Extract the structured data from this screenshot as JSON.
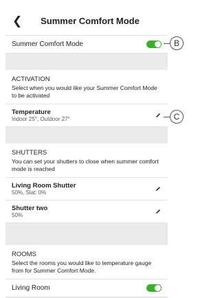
{
  "header": {
    "title": "Summer Comfort Mode",
    "back_icon": "chevron-left-icon"
  },
  "main_toggle": {
    "label": "Summer Comfort Mode",
    "state": "on",
    "color": "#3dae2b"
  },
  "activation": {
    "title": "ACTIVATION",
    "description": "Select when you would like your Summer Comfort Mode to be activated",
    "item": {
      "title": "Temperature",
      "subtitle": "Indoor 25°, Outdoor 27°"
    }
  },
  "shutters": {
    "title": "SHUTTERS",
    "description": "You can set your shutters to close when summer comfort mode is reached",
    "items": [
      {
        "title": "Living Room Shutter",
        "subtitle": "50%, Slat: 0%"
      },
      {
        "title": "Shutter two",
        "subtitle": "50%"
      }
    ]
  },
  "rooms": {
    "title": "ROOMS",
    "description": "Select the rooms you would like to temperature gauge from for Summer Comfort Mode.",
    "items": [
      {
        "label": "Living Room",
        "state": "on"
      }
    ]
  },
  "callouts": {
    "b": "B",
    "c": "C"
  }
}
